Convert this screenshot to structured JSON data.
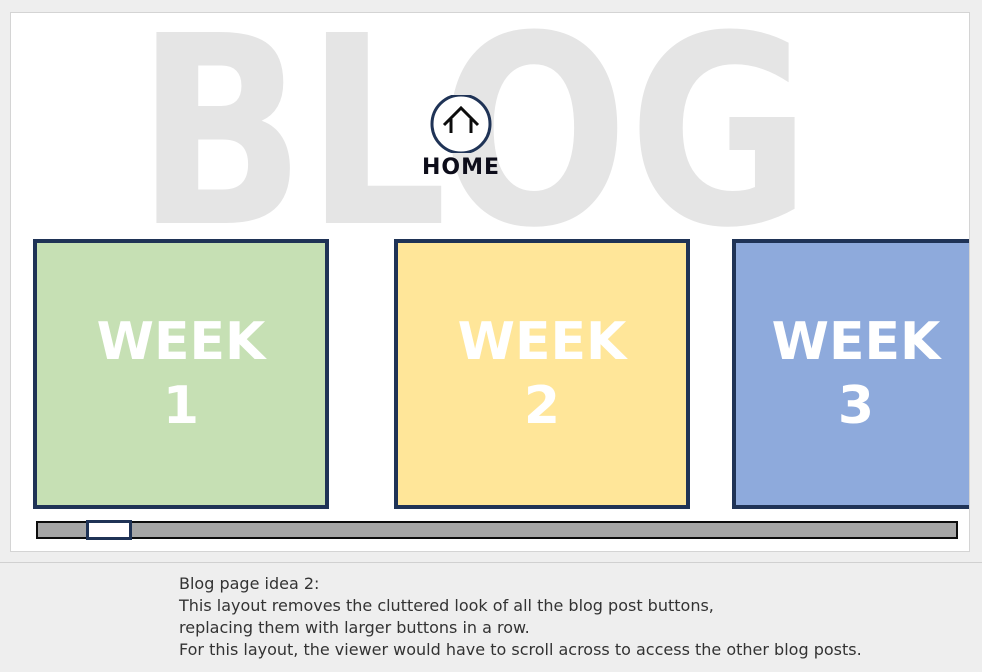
{
  "slide": {
    "watermark_text": "BLOG",
    "home": {
      "icon": "home-icon",
      "label": "HOME"
    },
    "weeks": [
      {
        "title": "WEEK",
        "number": "1",
        "color": "#c6e0b4"
      },
      {
        "title": "WEEK",
        "number": "2",
        "color": "#ffe699"
      },
      {
        "title": "WEEK",
        "number": "3",
        "color": "#8eaadc"
      }
    ],
    "border_color": "#1f3356",
    "scrollbar": {
      "thumb_position_fraction": 0.05
    }
  },
  "notes": {
    "lines": [
      "Blog page idea 2:",
      "This layout removes the cluttered look of all the blog post buttons,",
      "replacing them with larger buttons in a row.",
      "For this layout, the viewer would have to scroll across to access the other blog posts."
    ]
  }
}
